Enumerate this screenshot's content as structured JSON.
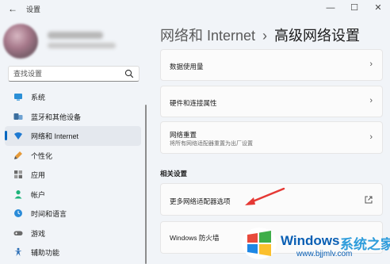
{
  "window": {
    "title": "设置",
    "back_glyph": "←",
    "controls": {
      "minimize": "—",
      "maximize": "☐",
      "close": "✕"
    }
  },
  "search": {
    "placeholder": "查找设置",
    "value": ""
  },
  "sidebar": {
    "items": [
      {
        "label": "系统",
        "icon": "monitor-icon",
        "active": false
      },
      {
        "label": "蓝牙和其他设备",
        "icon": "bluetooth-icon",
        "active": false
      },
      {
        "label": "网络和 Internet",
        "icon": "wifi-icon",
        "active": true
      },
      {
        "label": "个性化",
        "icon": "brush-icon",
        "active": false
      },
      {
        "label": "应用",
        "icon": "apps-icon",
        "active": false
      },
      {
        "label": "帐户",
        "icon": "person-icon",
        "active": false
      },
      {
        "label": "时间和语言",
        "icon": "globe-clock-icon",
        "active": false
      },
      {
        "label": "游戏",
        "icon": "gamepad-icon",
        "active": false
      },
      {
        "label": "辅助功能",
        "icon": "accessibility-icon",
        "active": false
      }
    ]
  },
  "breadcrumb": {
    "parent": "网络和 Internet",
    "separator": "›",
    "current": "高级网络设置"
  },
  "cards": {
    "data_usage": {
      "title": "数据使用量",
      "chevron": "›"
    },
    "hardware": {
      "title": "硬件和连接属性",
      "chevron": "›"
    },
    "reset": {
      "title": "网络重置",
      "desc": "将所有网络适配器重置为出厂设置",
      "chevron": "›"
    }
  },
  "related": {
    "heading": "相关设置",
    "more_adapters": {
      "title": "更多网络适配器选项"
    },
    "firewall": {
      "title": "Windows 防火墙"
    }
  },
  "watermark": {
    "brand": "Windows",
    "cn": "系统之家",
    "url": "www.bjjmlv.com"
  },
  "colors": {
    "accent": "#0067c0",
    "arrow": "#e53935",
    "background": "#f1f4f8",
    "card": "#fbfbfb"
  }
}
